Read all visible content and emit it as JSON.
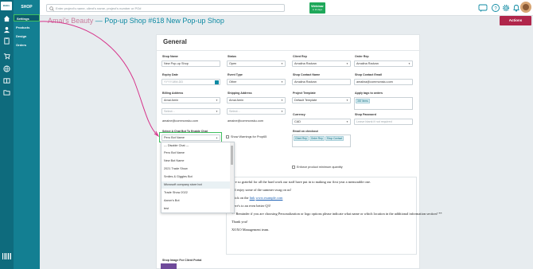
{
  "rail": {
    "logo_text": "BizEx"
  },
  "nav": {
    "heading": "SHOP",
    "items": [
      {
        "label": "Settings",
        "active": true
      },
      {
        "label": "Products",
        "active": false
      },
      {
        "label": "Design",
        "active": false
      },
      {
        "label": "Orders",
        "active": false
      }
    ]
  },
  "topbar": {
    "search_placeholder": "Enter project's name, client's name, project's number or PO#",
    "webinar_title": "Webinar",
    "webinar_sub": "in 21 days"
  },
  "page": {
    "store_name": "Amai's Beauty",
    "separator": " — ",
    "shop_title": "Pop-up Shop #618 New Pop-up Shop",
    "actions_label": "Actions"
  },
  "general": {
    "title": "General",
    "shop_name_label": "Shop Name",
    "shop_name_value": "New Pop-up Shop",
    "status_label": "Status",
    "status_value": "Open",
    "client_rep_label": "Client Rep",
    "client_rep_value": "Amalina Radvan",
    "order_rep_label": "Order Rep",
    "order_rep_value": "Amalina Radvan",
    "expiry_label": "Expiry Date",
    "expiry_placeholder": "YYYY-MM-DD",
    "event_type_label": "Event Type",
    "event_type_value": "Other",
    "contact_name_label": "Shop Contact Name",
    "contact_name_value": "Amalina Radvan",
    "contact_email_label": "Shop Contact Email",
    "contact_email_value": "amalina@commonsku.com",
    "billing_label": "Billing Address",
    "billing_value": "Amai Amin",
    "shipping_label": "Shipping Address",
    "shipping_value": "Amai Amin",
    "template_label": "Project Template",
    "template_value": "Default Template",
    "tags_label": "Apply tags to orders",
    "tags_value": "300 items",
    "billing_select": "Select...",
    "shipping_select": "Select...",
    "billing_email": "amaine@commonsku.com",
    "shipping_email": "amaine@commonsku.com",
    "currency_label": "Currency",
    "currency_value": "CAD",
    "password_label": "Shop Password",
    "password_placeholder": "Leave blank if not required",
    "chatbot_label": "Select A Chat Bot To Enable Chat",
    "chatbot_value": "Pero Bot Name",
    "warnings_label": "Show Warnings for Prop65",
    "email_checkout_label": "Email on checkout",
    "email_tags": [
      "Client Rep",
      "Order Rep",
      "Shop Contact"
    ],
    "enforce_label": "Enforce product minimum quantity"
  },
  "dropdown": {
    "options": [
      "--- Disable Chat ---",
      "Pero Bot Name",
      "New Bot Name",
      "2021 Trade Show",
      "Smiles & Giggles Bot",
      "Microsoft company store bot",
      "Trade Show 2022",
      "Aaron's Bot",
      "test"
    ],
    "selected_index": 5
  },
  "message": {
    "line1": "...re so grateful for all the hard work our staff have put in to making our first year a memorable one.",
    "line2": "...d enjoy some of the summer swag on us!",
    "line3_prefix": "Click on the",
    "line3_link": "link",
    "line3_url": "www.example.com",
    "line4": "Here's to an even better Q3!",
    "line5": "** Reminder if you are choosing Personalization or logo options please indicate what name or which location in the additional information section! **",
    "line6": "Thank you!",
    "line7": "XOXO Management team."
  },
  "footer": {
    "shop_image_label": "Shop Image For Client Portal"
  },
  "colors": {
    "accent": "#0e8aa3",
    "nav": "#137f92",
    "rail": "#0e6b7d",
    "highlight": "#3fbf5f",
    "actions": "#b0264b",
    "arrow": "#d6338a"
  },
  "icons": [
    "search-icon",
    "chat-icon",
    "help-icon",
    "settings-icon",
    "bell-icon",
    "home-icon",
    "users-icon",
    "clipboard-icon",
    "cart-icon",
    "globe-icon",
    "book-icon",
    "folder-icon",
    "barcode-icon",
    "calendar-icon"
  ]
}
